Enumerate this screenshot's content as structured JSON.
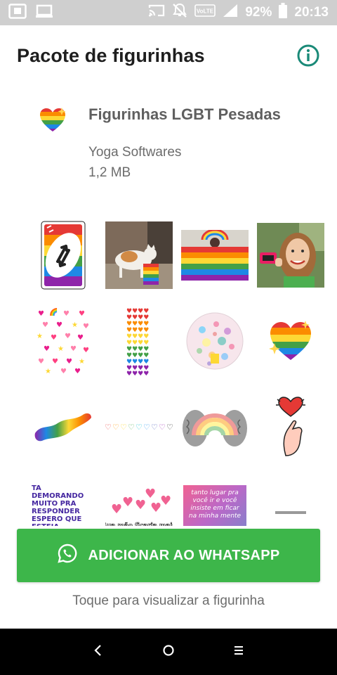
{
  "status_bar": {
    "battery_percent": "92%",
    "time": "20:13",
    "network_badge": "VoLTE"
  },
  "app_bar": {
    "title": "Pacote de figurinhas",
    "info_icon": "info-icon"
  },
  "pack": {
    "name": "Figurinhas LGBT Pesadas",
    "publisher": "Yoga Softwares",
    "size": "1,2 MB",
    "tray_icon": "rainbow-heart-icon"
  },
  "stickers": {
    "row4_sticker1_text": "TA DEMORANDO MUITO PRA RESPONDER ESPERO QUE ESTEJA PENSANDO NO NOSSO",
    "row4_sticker2_text": "Sua mão ficaria mais bonita encaixada na",
    "row4_sticker3_text": "tanto lugar pra você ir e você insiste em ficar na minha mente"
  },
  "actions": {
    "add_button_label": "ADICIONAR AO WHATSAPP",
    "hint": "Toque para visualizar a figurinha"
  },
  "colors": {
    "accent_green": "#3db64a",
    "info_teal": "#1a8a78"
  }
}
